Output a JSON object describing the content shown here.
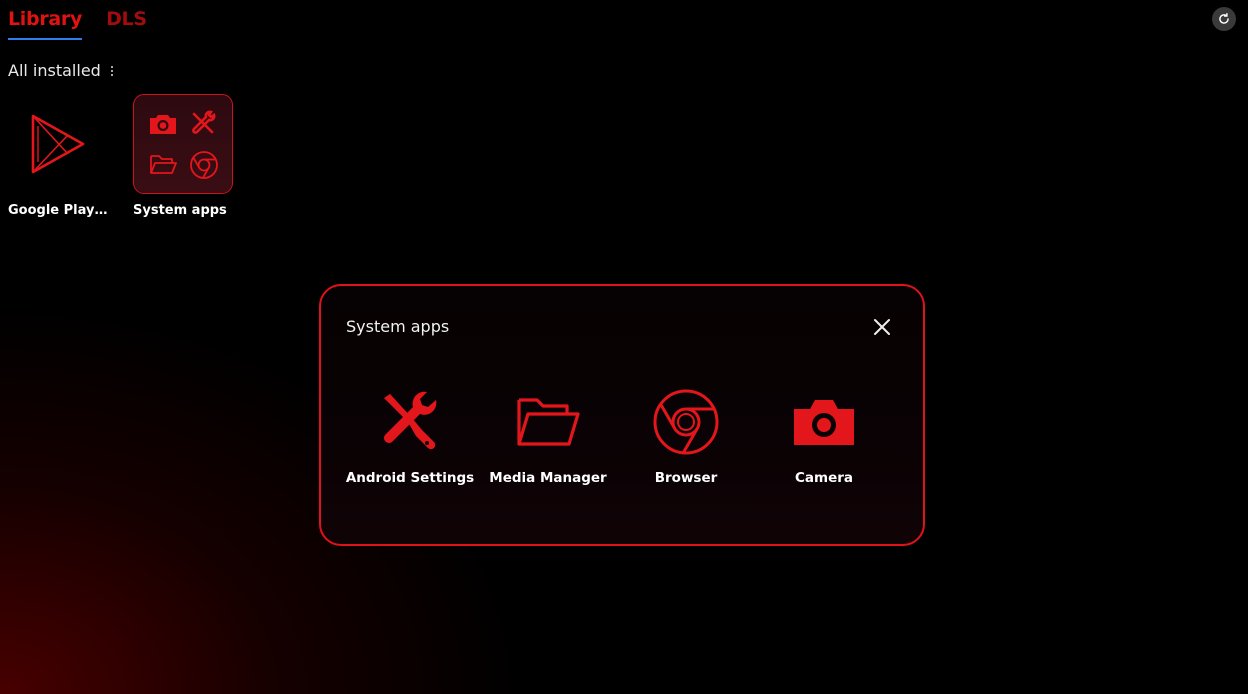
{
  "tabs": [
    {
      "label": "Library",
      "active": true
    },
    {
      "label": "DLS",
      "active": false
    }
  ],
  "filter": {
    "label": "All installed"
  },
  "library_apps": [
    {
      "label": "Google Play ...",
      "icon": "google-play-icon"
    },
    {
      "label": "System apps",
      "icon": "folder-group-icon"
    }
  ],
  "modal": {
    "title": "System apps",
    "apps": [
      {
        "label": "Android Settings",
        "icon": "tools-icon"
      },
      {
        "label": "Media Manager",
        "icon": "folder-icon"
      },
      {
        "label": "Browser",
        "icon": "browser-icon"
      },
      {
        "label": "Camera",
        "icon": "camera-icon"
      }
    ]
  },
  "colors": {
    "accent": "#e11212",
    "tab_inactive": "#a30c0c",
    "tab_underline": "#2f7cf0",
    "modal_border": "#e0121a"
  }
}
